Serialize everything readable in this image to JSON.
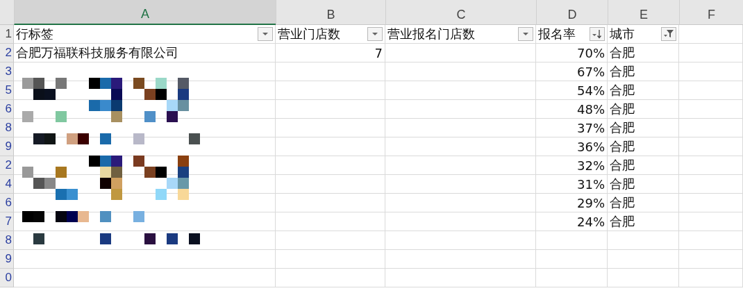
{
  "columns": [
    {
      "letter": "A",
      "selected": true
    },
    {
      "letter": "B",
      "selected": false
    },
    {
      "letter": "C",
      "selected": false
    },
    {
      "letter": "D",
      "selected": false
    },
    {
      "letter": "E",
      "selected": false
    },
    {
      "letter": "F",
      "selected": false
    }
  ],
  "header_row": {
    "row_number": "1",
    "cells": [
      {
        "label": "行标签",
        "kind": "dropdown"
      },
      {
        "label": "营业门店数",
        "kind": "dropdown"
      },
      {
        "label": "营业报名门店数",
        "kind": "dropdown"
      },
      {
        "label": "报名率",
        "kind": "sort"
      },
      {
        "label": "城市",
        "kind": "filter"
      },
      {
        "kind": "blank"
      }
    ]
  },
  "rows": [
    {
      "row_number": "2",
      "label": "合肥万福联科技服务有限公司",
      "stores": "7",
      "rate": "70%",
      "city": "合肥"
    },
    {
      "row_number": "3",
      "rate": "67%",
      "city": "合肥"
    },
    {
      "row_number": "5",
      "rate": "54%",
      "city": "合肥"
    },
    {
      "row_number": "6",
      "rate": "48%",
      "city": "合肥"
    },
    {
      "row_number": "8",
      "rate": "37%",
      "city": "合肥"
    },
    {
      "row_number": "9",
      "rate": "36%",
      "city": "合肥"
    },
    {
      "row_number": "2",
      "rate": "32%",
      "city": "合肥"
    },
    {
      "row_number": "4",
      "rate": "31%",
      "city": "合肥"
    },
    {
      "row_number": "6",
      "rate": "29%",
      "city": "合肥"
    },
    {
      "row_number": "7",
      "rate": "24%",
      "city": "合肥"
    },
    {
      "row_number": "8"
    },
    {
      "row_number": "9"
    },
    {
      "row_number": "0"
    }
  ]
}
